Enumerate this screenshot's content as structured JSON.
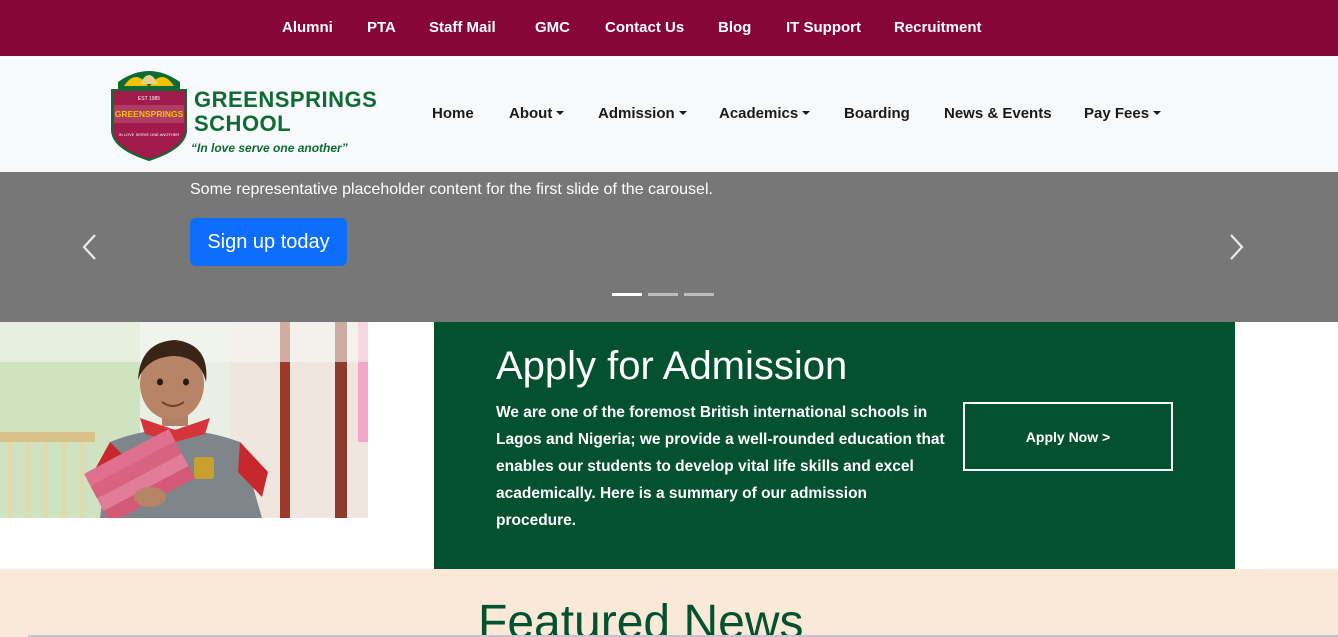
{
  "topbar": {
    "links": [
      "Alumni",
      "PTA",
      "Staff Mail",
      "GMC",
      "Contact Us",
      "Blog",
      "IT Support",
      "Recruitment"
    ]
  },
  "logo": {
    "name_line1": "GREENSPRINGS",
    "name_line2": "SCHOOL",
    "tagline": "“In love serve one another”",
    "crest_est": "EST 1985",
    "crest_name": "GREENSPRINGS",
    "crest_motto": "IN LOVE SERVE ONE ANOTHER"
  },
  "nav": {
    "home": "Home",
    "about": "About",
    "admission": "Admission",
    "academics": "Academics",
    "boarding": "Boarding",
    "news_events": "News & Events",
    "pay_fees": "Pay Fees"
  },
  "carousel": {
    "caption": "Some representative placeholder content for the first slide of the carousel.",
    "button": "Sign up today",
    "slides_total": 3,
    "active_slide": 1
  },
  "apply": {
    "title": "Apply for Admission",
    "body": "We are one of the foremost British international schools in Lagos and Nigeria; we provide a well-rounded education that enables our students to develop vital life skills and excel academically. Here is a summary of our admission procedure.",
    "button": "Apply Now >"
  },
  "featured": {
    "title": "Featured News"
  },
  "colors": {
    "brand_maroon": "#86063a",
    "brand_green": "#04512f",
    "primary_blue": "#0d6efd",
    "carousel_gray": "#777777",
    "cream": "#f9e9d6"
  },
  "icons": {
    "prev": "chevron-left-icon",
    "next": "chevron-right-icon",
    "dropdown": "caret-down-icon"
  }
}
